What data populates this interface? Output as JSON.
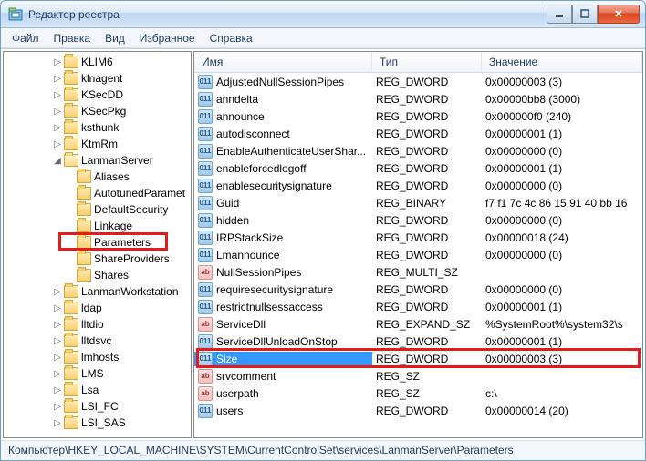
{
  "window": {
    "title": "Редактор реестра"
  },
  "menu": [
    "Файл",
    "Правка",
    "Вид",
    "Избранное",
    "Справка"
  ],
  "tree": [
    {
      "indent": 52,
      "exp": "▷",
      "ico": "closed",
      "label": "KLIM6"
    },
    {
      "indent": 52,
      "exp": "▷",
      "ico": "closed",
      "label": "klnagent"
    },
    {
      "indent": 52,
      "exp": "▷",
      "ico": "closed",
      "label": "KSecDD"
    },
    {
      "indent": 52,
      "exp": "▷",
      "ico": "closed",
      "label": "KSecPkg"
    },
    {
      "indent": 52,
      "exp": "▷",
      "ico": "closed",
      "label": "ksthunk"
    },
    {
      "indent": 52,
      "exp": "▷",
      "ico": "closed",
      "label": "KtmRm"
    },
    {
      "indent": 52,
      "exp": "◢",
      "ico": "open",
      "label": "LanmanServer"
    },
    {
      "indent": 66,
      "exp": "",
      "ico": "closed",
      "label": "Aliases"
    },
    {
      "indent": 66,
      "exp": "",
      "ico": "closed",
      "label": "AutotunedParamet"
    },
    {
      "indent": 66,
      "exp": "",
      "ico": "closed",
      "label": "DefaultSecurity"
    },
    {
      "indent": 66,
      "exp": "",
      "ico": "closed",
      "label": "Linkage"
    },
    {
      "indent": 66,
      "exp": "",
      "ico": "closed",
      "label": "Parameters",
      "hl": true
    },
    {
      "indent": 66,
      "exp": "",
      "ico": "closed",
      "label": "ShareProviders"
    },
    {
      "indent": 66,
      "exp": "",
      "ico": "closed",
      "label": "Shares"
    },
    {
      "indent": 52,
      "exp": "▷",
      "ico": "closed",
      "label": "LanmanWorkstation"
    },
    {
      "indent": 52,
      "exp": "▷",
      "ico": "closed",
      "label": "ldap"
    },
    {
      "indent": 52,
      "exp": "▷",
      "ico": "closed",
      "label": "lltdio"
    },
    {
      "indent": 52,
      "exp": "▷",
      "ico": "closed",
      "label": "lltdsvc"
    },
    {
      "indent": 52,
      "exp": "▷",
      "ico": "closed",
      "label": "lmhosts"
    },
    {
      "indent": 52,
      "exp": "▷",
      "ico": "closed",
      "label": "LMS"
    },
    {
      "indent": 52,
      "exp": "▷",
      "ico": "closed",
      "label": "Lsa"
    },
    {
      "indent": 52,
      "exp": "▷",
      "ico": "closed",
      "label": "LSI_FC"
    },
    {
      "indent": 52,
      "exp": "▷",
      "ico": "closed",
      "label": "LSI_SAS"
    }
  ],
  "columns": {
    "name": "Имя",
    "type": "Тип",
    "data": "Значение"
  },
  "values": [
    {
      "ico": "bin",
      "name": "AdjustedNullSessionPipes",
      "type": "REG_DWORD",
      "data": "0x00000003 (3)"
    },
    {
      "ico": "bin",
      "name": "anndelta",
      "type": "REG_DWORD",
      "data": "0x00000bb8 (3000)"
    },
    {
      "ico": "bin",
      "name": "announce",
      "type": "REG_DWORD",
      "data": "0x000000f0 (240)"
    },
    {
      "ico": "bin",
      "name": "autodisconnect",
      "type": "REG_DWORD",
      "data": "0x00000001 (1)"
    },
    {
      "ico": "bin",
      "name": "EnableAuthenticateUserShar...",
      "type": "REG_DWORD",
      "data": "0x00000000 (0)"
    },
    {
      "ico": "bin",
      "name": "enableforcedlogoff",
      "type": "REG_DWORD",
      "data": "0x00000001 (1)"
    },
    {
      "ico": "bin",
      "name": "enablesecuritysignature",
      "type": "REG_DWORD",
      "data": "0x00000000 (0)"
    },
    {
      "ico": "bin",
      "name": "Guid",
      "type": "REG_BINARY",
      "data": "f7 f1 7c 4c 86 15 91 40 bb 16"
    },
    {
      "ico": "bin",
      "name": "hidden",
      "type": "REG_DWORD",
      "data": "0x00000000 (0)"
    },
    {
      "ico": "bin",
      "name": "IRPStackSize",
      "type": "REG_DWORD",
      "data": "0x00000018 (24)"
    },
    {
      "ico": "bin",
      "name": "Lmannounce",
      "type": "REG_DWORD",
      "data": "0x00000000 (0)"
    },
    {
      "ico": "str",
      "name": "NullSessionPipes",
      "type": "REG_MULTI_SZ",
      "data": ""
    },
    {
      "ico": "bin",
      "name": "requiresecuritysignature",
      "type": "REG_DWORD",
      "data": "0x00000000 (0)"
    },
    {
      "ico": "bin",
      "name": "restrictnullsessaccess",
      "type": "REG_DWORD",
      "data": "0x00000001 (1)"
    },
    {
      "ico": "str",
      "name": "ServiceDll",
      "type": "REG_EXPAND_SZ",
      "data": "%SystemRoot%\\system32\\s"
    },
    {
      "ico": "bin",
      "name": "ServiceDllUnloadOnStop",
      "type": "REG_DWORD",
      "data": "0x00000001 (1)"
    },
    {
      "ico": "bin",
      "name": "Size",
      "type": "REG_DWORD",
      "data": "0x00000003 (3)",
      "sel": true,
      "hl": true
    },
    {
      "ico": "str",
      "name": "srvcomment",
      "type": "REG_SZ",
      "data": ""
    },
    {
      "ico": "str",
      "name": "userpath",
      "type": "REG_SZ",
      "data": "c:\\"
    },
    {
      "ico": "bin",
      "name": "users",
      "type": "REG_DWORD",
      "data": "0x00000014 (20)"
    }
  ],
  "status": "Компьютер\\HKEY_LOCAL_MACHINE\\SYSTEM\\CurrentControlSet\\services\\LanmanServer\\Parameters"
}
